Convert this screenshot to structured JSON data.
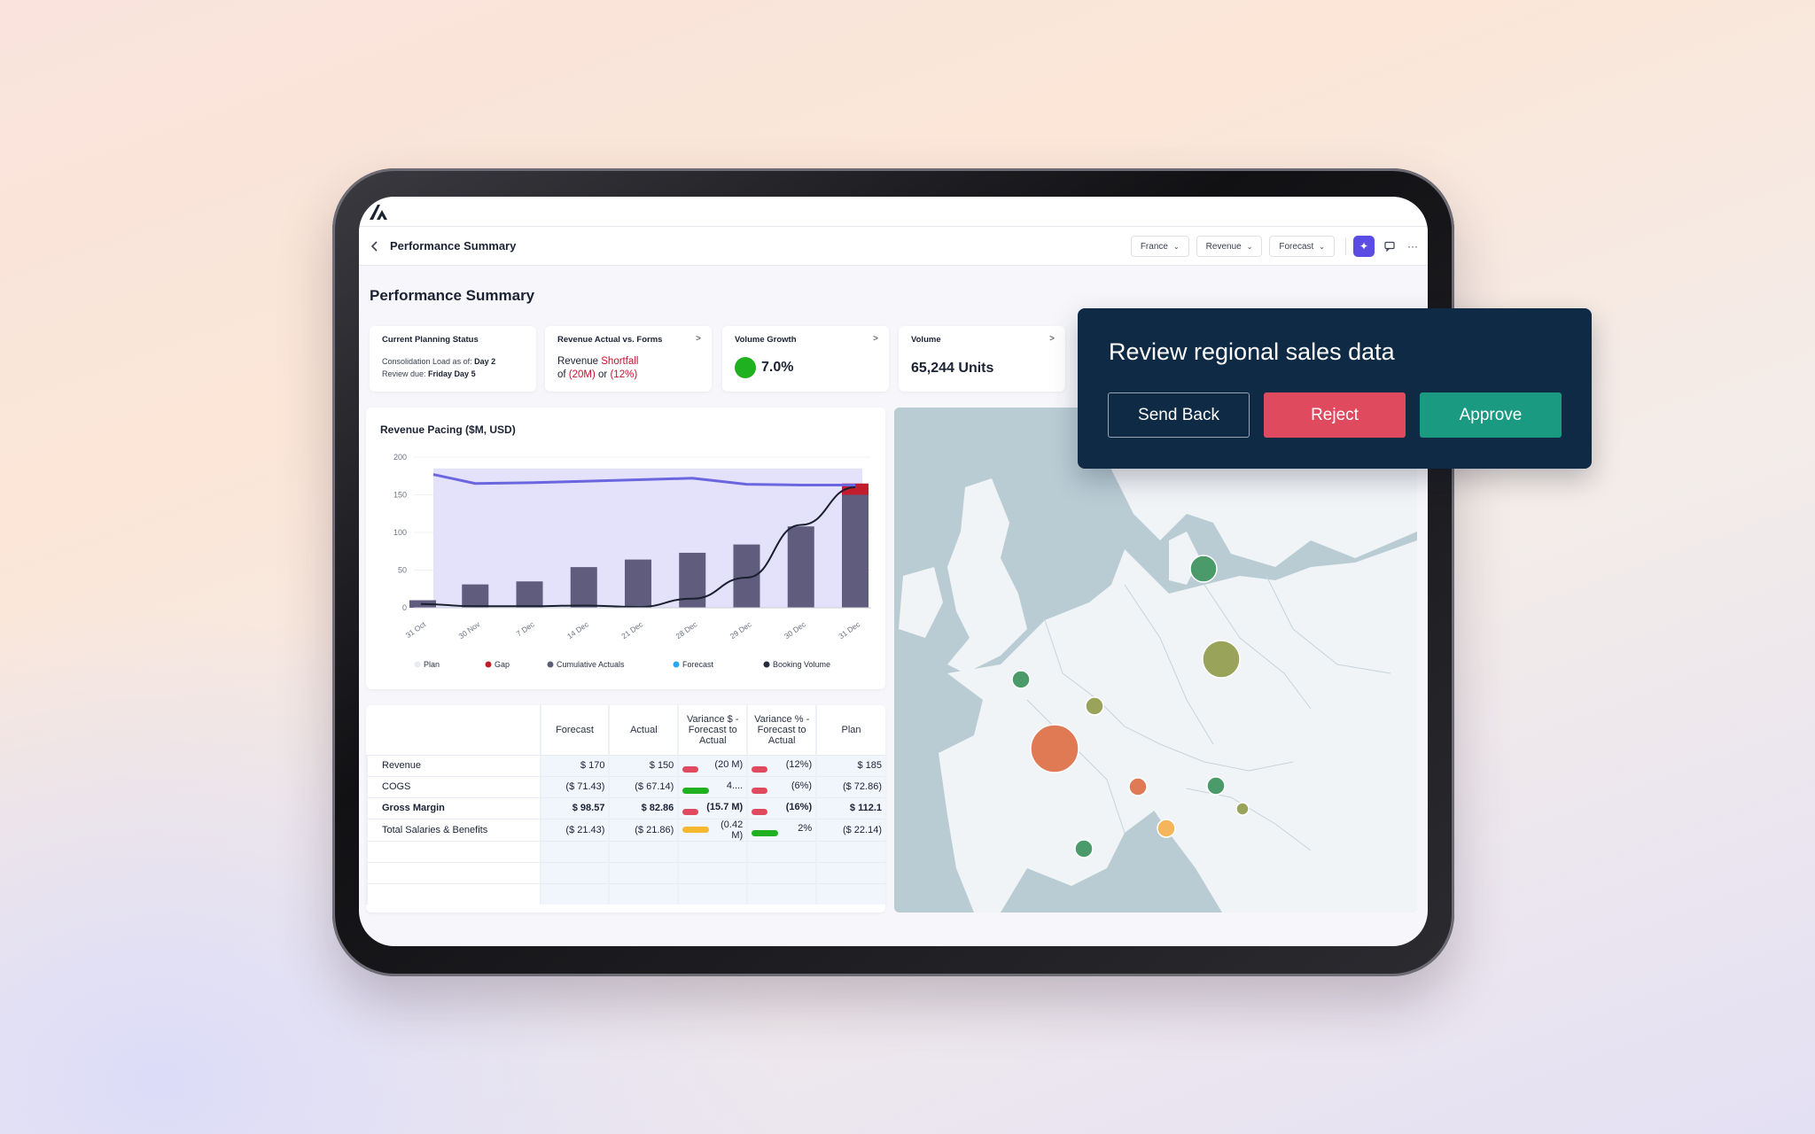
{
  "app": {
    "page_title": "Performance Summary",
    "filters": [
      "France",
      "Revenue",
      "Forecast"
    ]
  },
  "main": {
    "title": "Performance Summary",
    "kpis": {
      "planning": {
        "title": "Current Planning Status",
        "line1_label": "Consolidation Load as of:",
        "line1_value": "Day 2",
        "line2_label": "Review due:",
        "line2_value": "Friday Day 5"
      },
      "revenue": {
        "title": "Revenue Actual vs. Forms",
        "arrow": ">",
        "word_revenue": "Revenue",
        "word_shortfall": "Shortfall",
        "word_of": "of",
        "value_amount": "(20M)",
        "word_or": "or",
        "value_pct": "(12%)"
      },
      "volume_growth": {
        "title": "Volume Growth",
        "arrow": ">",
        "value": "7.0%"
      },
      "volume": {
        "title": "Volume",
        "arrow": ">",
        "value": "65,244 Units"
      }
    }
  },
  "chart_data": {
    "type": "bar",
    "title": "Revenue Pacing ($M, USD)",
    "categories": [
      "31 Oct",
      "30 Nov",
      "7 Dec",
      "14 Dec",
      "21 Dec",
      "28 Dec",
      "29 Dec",
      "30 Dec",
      "31 Dec"
    ],
    "ylim": [
      0,
      200
    ],
    "yticks": [
      0,
      50,
      100,
      150,
      200
    ],
    "series": [
      {
        "name": "Plan",
        "type": "area",
        "values": [
          185,
          185,
          185,
          185,
          185,
          185,
          185,
          185,
          185
        ]
      },
      {
        "name": "Forecast",
        "type": "line",
        "values": [
          177,
          165,
          166,
          168,
          170,
          172,
          164,
          163,
          163
        ]
      },
      {
        "name": "Booking Volume",
        "type": "bar",
        "values": [
          10,
          31,
          35,
          54,
          64,
          73,
          84,
          108,
          150
        ]
      },
      {
        "name": "Gap",
        "type": "bar",
        "values": [
          0,
          0,
          0,
          0,
          0,
          0,
          0,
          0,
          15
        ]
      },
      {
        "name": "Cumulative Actuals",
        "type": "line",
        "values": [
          5,
          2,
          2,
          3,
          1,
          12,
          40,
          110,
          160
        ]
      }
    ],
    "legend": [
      {
        "name": "Plan",
        "color": "#e9e9f2"
      },
      {
        "name": "Gap",
        "color": "#c21d2c"
      },
      {
        "name": "Cumulative Actuals",
        "color": "#5a6072"
      },
      {
        "name": "Forecast",
        "color": "#2aa7e8"
      },
      {
        "name": "Booking Volume",
        "color": "#262a3d"
      }
    ],
    "legend_position": "bottom",
    "colors": {
      "plan_fill": "#e3e2fa",
      "forecast_line": "#6b66e0",
      "bar": "#5f5c7e",
      "gap": "#c21d2c",
      "actuals_line": "#1b2030"
    }
  },
  "table": {
    "headers": [
      "Forecast",
      "Actual",
      "Variance $ - Forecast to Actual",
      "Variance % - Forecast to Actual",
      "Plan"
    ],
    "rows": [
      {
        "label": "Revenue",
        "forecast": "$ 170",
        "actual": "$ 150",
        "var_amt": "(20 M)",
        "var_amt_color": "#e04a5f",
        "var_pct": "(12%)",
        "var_pct_color": "#e04a5f",
        "plan": "$ 185",
        "bold": false
      },
      {
        "label": "COGS",
        "forecast": "($ 71.43)",
        "actual": "($ 67.14)",
        "var_amt": "4....",
        "var_amt_color": "#1fb11f",
        "var_pct": "(6%)",
        "var_pct_color": "#e04a5f",
        "plan": "($ 72.86)",
        "bold": false
      },
      {
        "label": "Gross Margin",
        "forecast": "$ 98.57",
        "actual": "$ 82.86",
        "var_amt": "(15.7 M)",
        "var_amt_color": "#e04a5f",
        "var_pct": "(16%)",
        "var_pct_color": "#e04a5f",
        "plan": "$ 112.1",
        "bold": true
      },
      {
        "label": "Total Salaries & Benefits",
        "forecast": "($ 21.43)",
        "actual": "($ 21.86)",
        "var_amt": "(0.42 M)",
        "var_amt_color": "#f5b82e",
        "var_pct": "2%",
        "var_pct_color": "#1fb11f",
        "plan": "($ 22.14)",
        "bold": false
      }
    ]
  },
  "map": {
    "markers": [
      {
        "name": "denmark-marker",
        "color": "#4a9a6a"
      },
      {
        "name": "germany-east-marker",
        "color": "#9aa35a"
      },
      {
        "name": "uk-marker",
        "color": "#4a9a6a"
      },
      {
        "name": "belgium-marker",
        "color": "#9aa35a"
      },
      {
        "name": "france-marker",
        "color": "#e07a55"
      },
      {
        "name": "switzerland-marker",
        "color": "#e07a55"
      },
      {
        "name": "austria-marker",
        "color": "#4a9a6a"
      },
      {
        "name": "slovenia-marker",
        "color": "#9aa35a"
      },
      {
        "name": "italy-north-marker",
        "color": "#f5b55a"
      },
      {
        "name": "france-south-marker",
        "color": "#4a9a6a"
      }
    ]
  },
  "review": {
    "title": "Review regional sales data",
    "send_back": "Send Back",
    "reject": "Reject",
    "approve": "Approve"
  }
}
